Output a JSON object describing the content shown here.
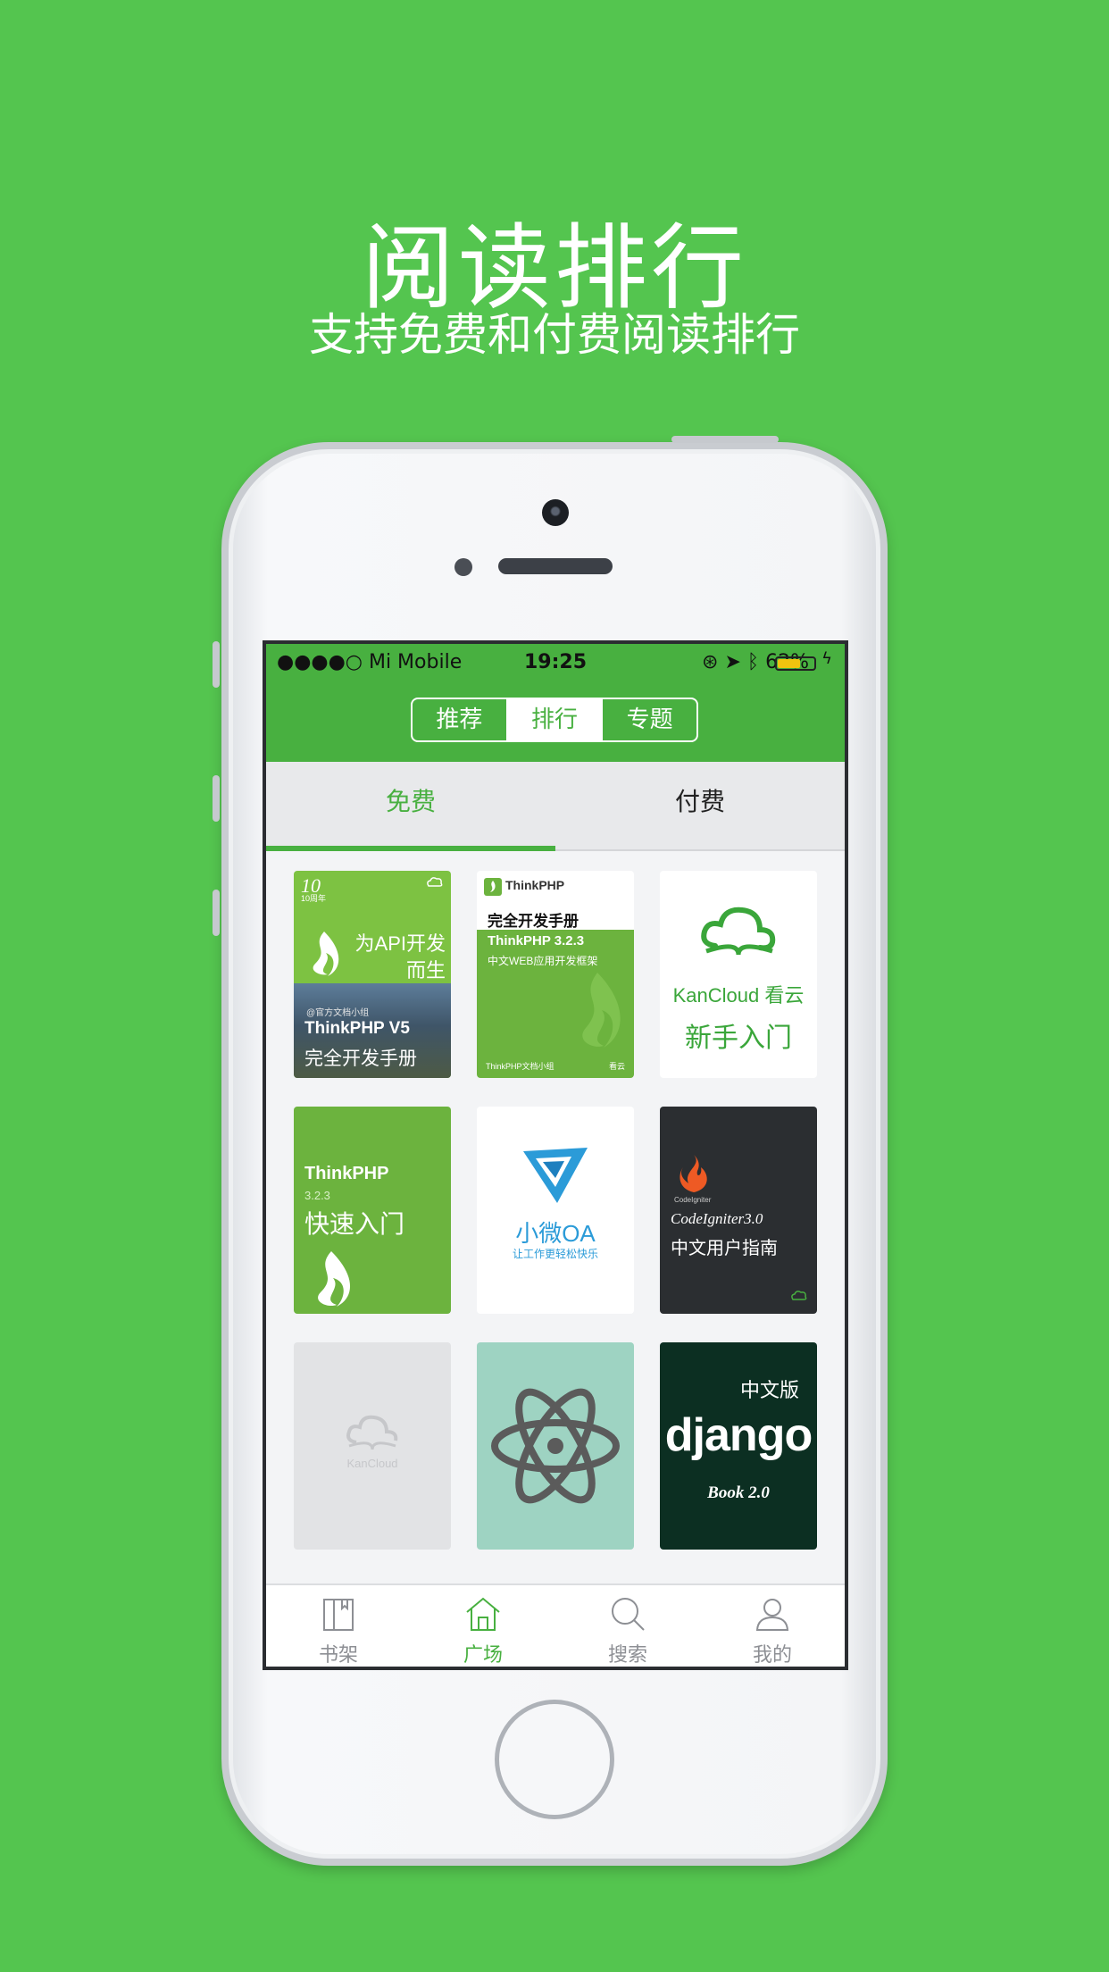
{
  "promo": {
    "headline": "阅读排行",
    "subline": "支持免费和付费阅读排行"
  },
  "status_bar": {
    "carrier": "●●●●○ Mi Mobile",
    "time": "19:25",
    "battery": "62%",
    "battery_level": 0.62
  },
  "segments": [
    {
      "label": "推荐",
      "active": false
    },
    {
      "label": "排行",
      "active": true
    },
    {
      "label": "专题",
      "active": false
    }
  ],
  "subtabs": [
    {
      "label": "免费",
      "active": true
    },
    {
      "label": "付费",
      "active": false
    }
  ],
  "books": [
    {
      "cover": "thinkphp-v5",
      "lines": [
        "为API开发",
        "而生",
        "ThinkPHP V5",
        "完全开发手册",
        "@官方文档小组",
        "10周年"
      ]
    },
    {
      "cover": "thinkphp-323-manual",
      "lines": [
        "ThinkPHP",
        "完全开发手册",
        "ThinkPHP 3.2.3",
        "中文WEB应用开发框架",
        "ThinkPHP文档小组",
        "看云"
      ]
    },
    {
      "cover": "kancloud-newbie",
      "lines": [
        "KanCloud 看云",
        "新手入门"
      ]
    },
    {
      "cover": "thinkphp-quickstart",
      "lines": [
        "ThinkPHP",
        "3.2.3",
        "快速入门"
      ]
    },
    {
      "cover": "xiaowei-oa",
      "lines": [
        "小微OA",
        "让工作更轻松快乐"
      ]
    },
    {
      "cover": "codeigniter",
      "lines": [
        "CodeIgniter",
        "CodeIgniter3.0",
        "中文用户指南"
      ]
    },
    {
      "cover": "kancloud-placeholder",
      "lines": [
        "KanCloud"
      ]
    },
    {
      "cover": "atom",
      "lines": []
    },
    {
      "cover": "django",
      "lines": [
        "中文版",
        "django",
        "Book 2.0"
      ]
    }
  ],
  "tabbar": [
    {
      "label": "书架",
      "icon": "bookshelf-icon",
      "active": false
    },
    {
      "label": "广场",
      "icon": "home-icon",
      "active": true
    },
    {
      "label": "搜索",
      "icon": "search-icon",
      "active": false
    },
    {
      "label": "我的",
      "icon": "profile-icon",
      "active": false
    }
  ],
  "colors": {
    "background": "#54c54f",
    "accent": "#48b040"
  }
}
